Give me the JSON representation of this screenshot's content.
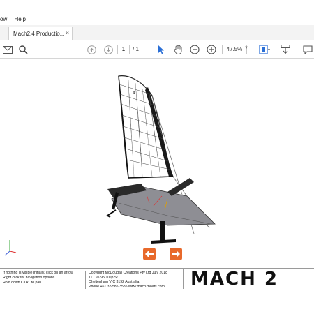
{
  "menubar": {
    "items": [
      "ow",
      "Help"
    ]
  },
  "tab": {
    "title": "Mach2.4 Productio...",
    "close": "×"
  },
  "toolbar": {
    "page_current": "1",
    "page_total": "/ 1",
    "zoom": "47.5%",
    "icons": [
      "mail-icon",
      "search-icon",
      "page-up-icon",
      "page-down-icon",
      "select-cursor-icon",
      "hand-icon",
      "zoom-out-icon",
      "zoom-in-icon",
      "fit-page-icon",
      "scroll-mode-icon",
      "comment-icon"
    ]
  },
  "footer": {
    "instructions": [
      "If nothing is visible initially, click on an arrow",
      "Right click for navigation options",
      "Hold down CTRL to pan"
    ],
    "copyright": [
      "Copyright McDougall Creations Pty Ltd July 2018",
      "11 / 91-95 Tulip St",
      "Cheltenham VIC 3192 Australia",
      "Phone +61 3 9585 3585   www.mach2boats.com"
    ],
    "brand": "MACH 2"
  },
  "colors": {
    "accent": "#e8692b",
    "toolbar_icon": "#555555",
    "select_icon": "#2b6fd6"
  }
}
